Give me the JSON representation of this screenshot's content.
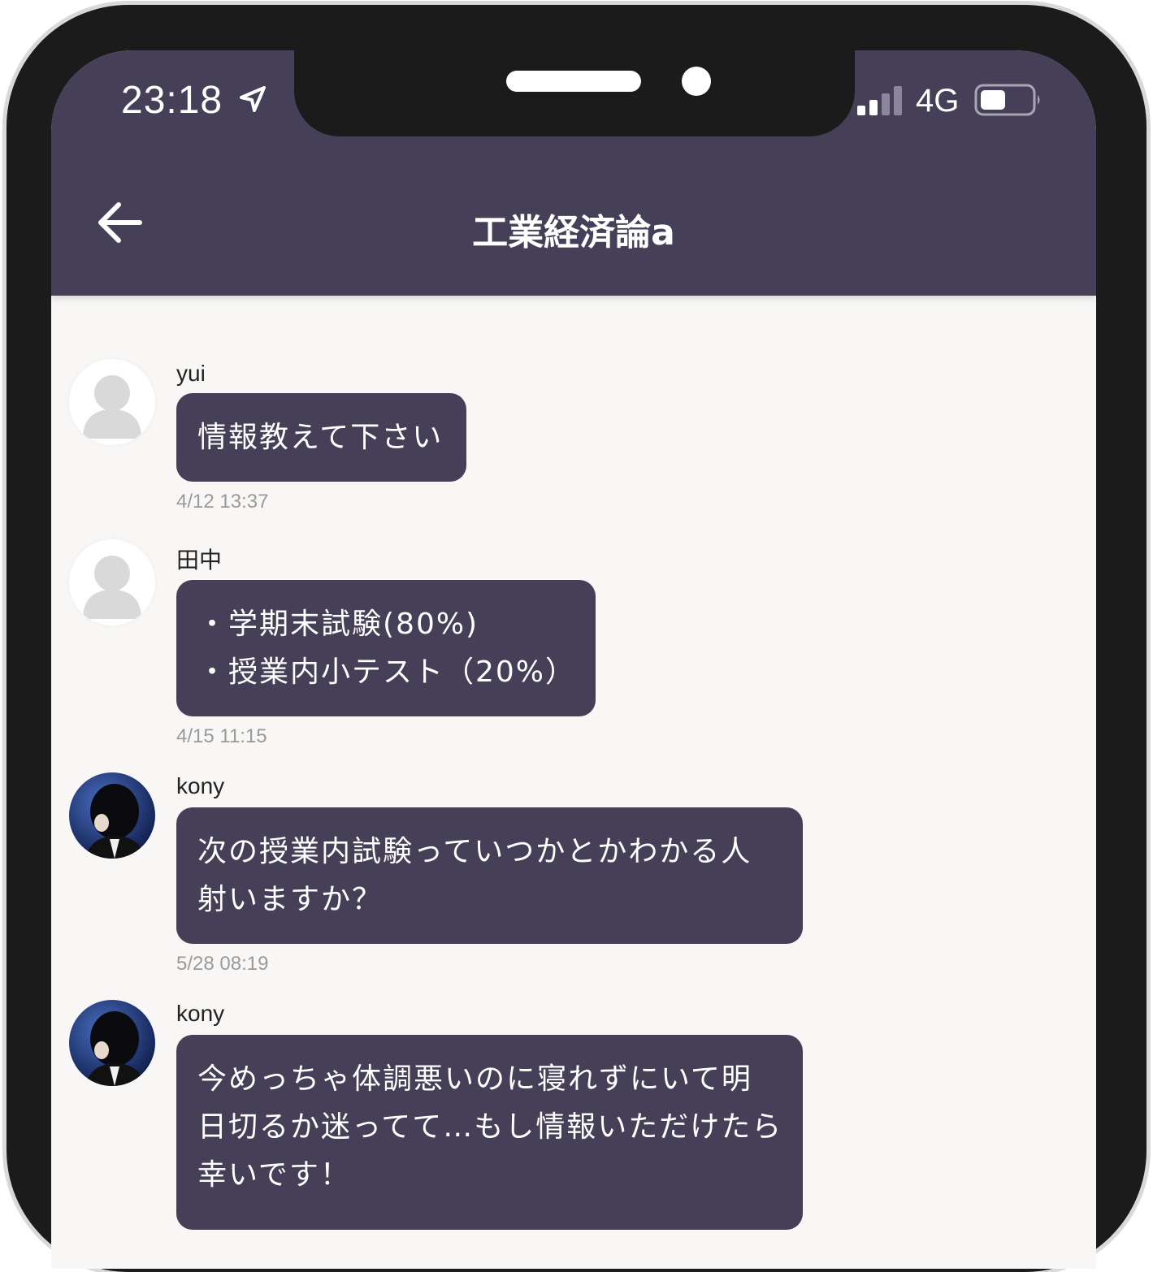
{
  "status_bar": {
    "time": "23:18",
    "network": "4G",
    "location_icon": "location-arrow-icon",
    "signal_icon": "signal-bars-icon",
    "battery_icon": "battery-icon",
    "signal_bars_active": 2,
    "signal_bars_total": 4,
    "battery_level": 0.45
  },
  "header": {
    "title": "工業経済論a",
    "back_icon": "back-arrow-icon"
  },
  "colors": {
    "header_bg": "#463f58",
    "bubble_bg": "#463f58",
    "chat_bg": "#f8f7f6"
  },
  "messages": [
    {
      "name": "yui",
      "avatar": "default-avatar",
      "lines": [
        "情報教えて下さい"
      ],
      "time": "4/12 13:37"
    },
    {
      "name": "田中",
      "avatar": "default-avatar",
      "lines": [
        "・学期末試験(80%)",
        "・授業内小テスト（20%）"
      ],
      "time": "4/15 11:15"
    },
    {
      "name": "kony",
      "avatar": "photo-avatar",
      "lines": [
        "次の授業内試験っていつかとかわかる人",
        "射いますか？"
      ],
      "time": "5/28 08:19"
    },
    {
      "name": "kony",
      "avatar": "photo-avatar",
      "lines": [
        "今めっちゃ体調悪いのに寝れずにいて明",
        "日切るか迷ってて…もし情報いただけたら",
        "幸いです！"
      ],
      "time": ""
    }
  ]
}
